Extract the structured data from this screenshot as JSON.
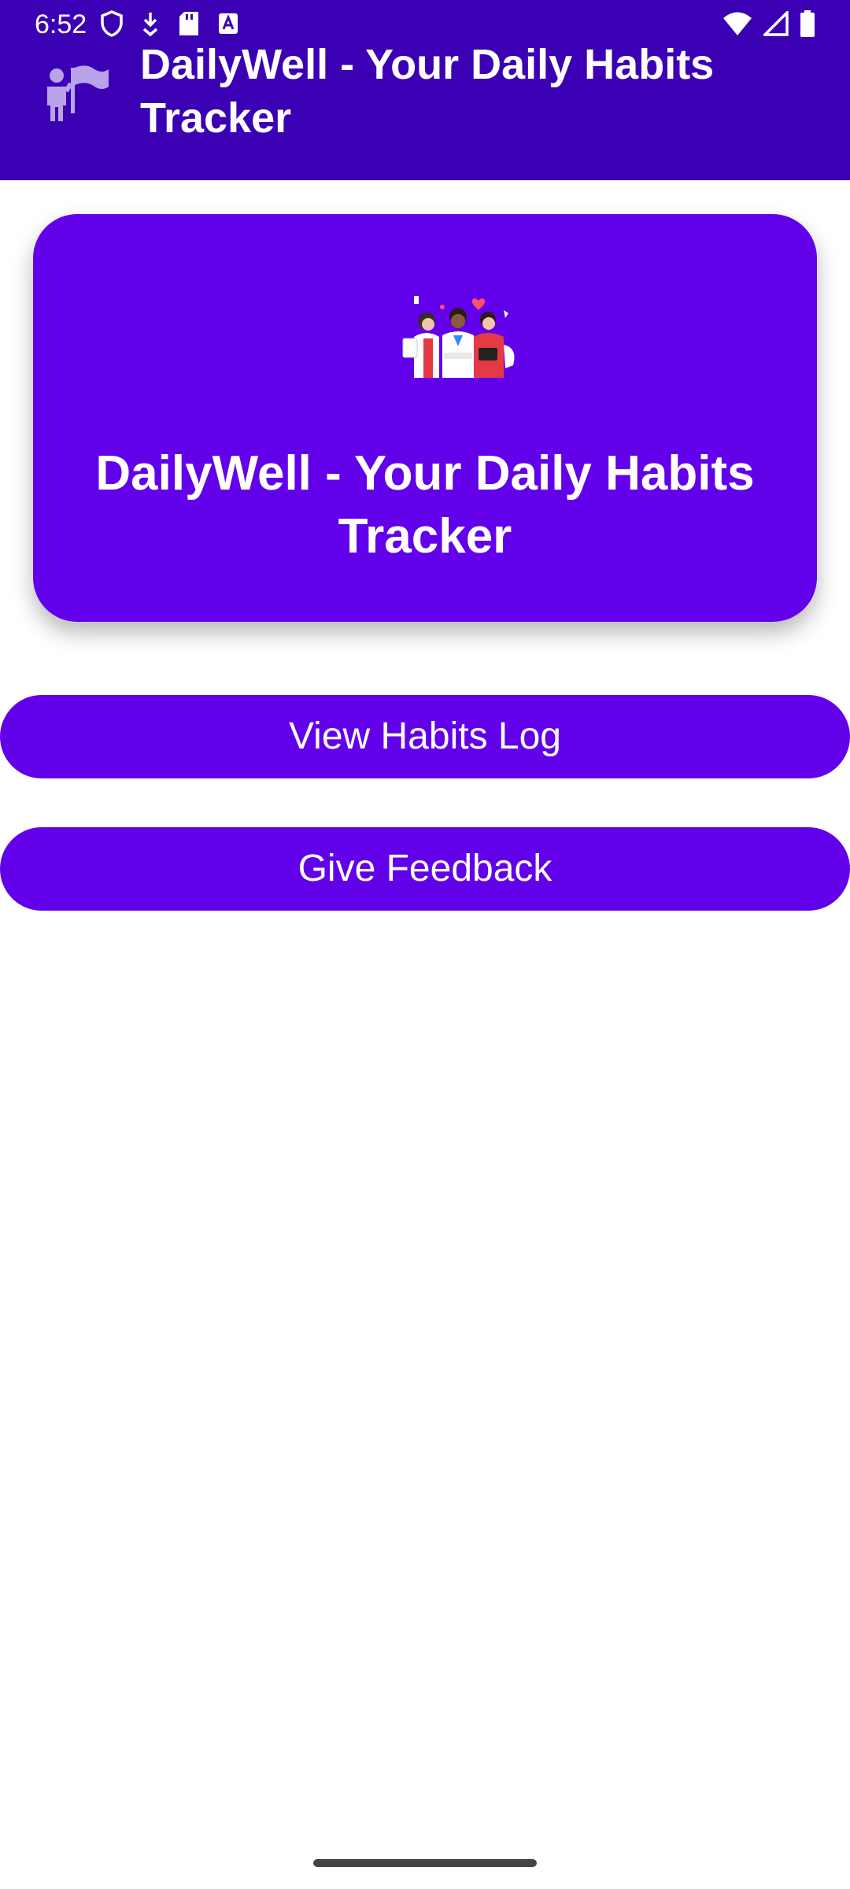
{
  "status_bar": {
    "time": "6:52",
    "left_icons": [
      "shield-icon",
      "download-icon",
      "sd-card-icon",
      "accessibility-a-icon"
    ],
    "right_icons": [
      "wifi-icon",
      "signal-icon",
      "battery-icon"
    ]
  },
  "app_bar": {
    "title": "DailyWell - Your Daily Habits Tracker",
    "logo_icon": "person-flag-icon",
    "background": "#3b00b3"
  },
  "hero": {
    "title": "DailyWell - Your Daily Habits Tracker",
    "illustration": "team-illustration",
    "background": "#6200ea"
  },
  "buttons": {
    "view_log": "View Habits Log",
    "feedback": "Give Feedback"
  },
  "colors": {
    "accent": "#6200ea",
    "app_bar": "#3b00b3",
    "text_on_accent": "#ffffff"
  }
}
